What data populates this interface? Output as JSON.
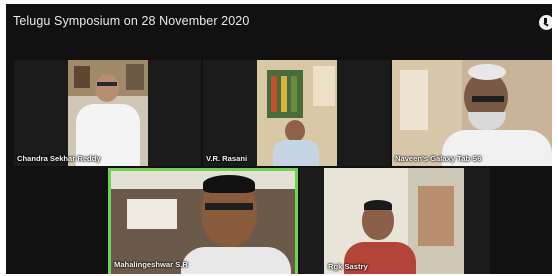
{
  "header": {
    "title": "Telugu Symposium on 28 November 2020",
    "info_icon": "clock-info-icon"
  },
  "participants": [
    {
      "name": "Chandra Sekhar Reddy",
      "active_speaker": false
    },
    {
      "name": "V.R. Rasani",
      "active_speaker": false
    },
    {
      "name": "Naveen's Galaxy Tab S6",
      "active_speaker": false
    },
    {
      "name": "Mahalingeshwar S.R",
      "active_speaker": true
    },
    {
      "name": "Rgk Sastry",
      "active_speaker": false
    }
  ],
  "colors": {
    "background": "#111111",
    "active_border": "#6fd255",
    "label_text": "#f3f3f3"
  }
}
